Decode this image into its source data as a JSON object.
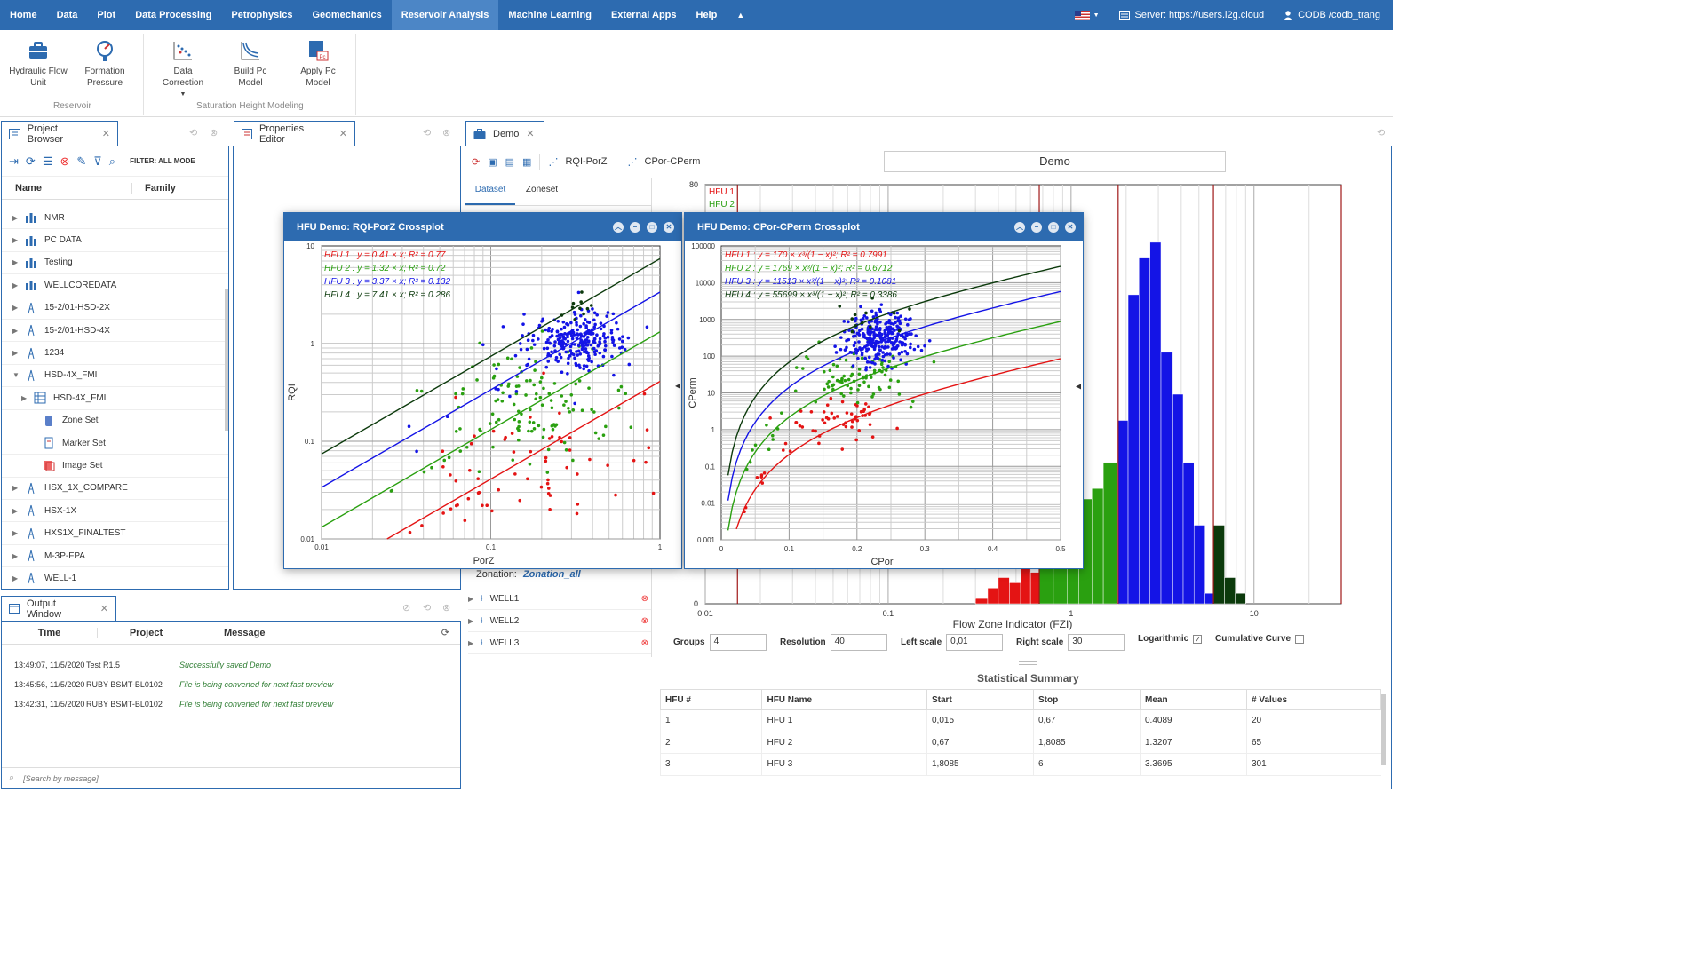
{
  "menu": {
    "items": [
      "Home",
      "Data",
      "Plot",
      "Data Processing",
      "Petrophysics",
      "Geomechanics",
      "Reservoir Analysis",
      "Machine Learning",
      "External Apps",
      "Help"
    ],
    "active": "Reservoir Analysis",
    "server": "Server: https://users.i2g.cloud",
    "user": "CODB /codb_trang"
  },
  "ribbon": {
    "hfu_line1": "Hydraulic Flow",
    "hfu_line2": "Unit",
    "fp_line1": "Formation",
    "fp_line2": "Pressure",
    "dc_line1": "Data",
    "dc_line2": "Correction",
    "bpc_line1": "Build Pc",
    "bpc_line2": "Model",
    "apc_line1": "Apply Pc",
    "apc_line2": "Model",
    "group_reservoir": "Reservoir",
    "group_shm": "Saturation Height Modeling"
  },
  "project": {
    "tab": "Project Browser",
    "filter": "FILTER: ALL MODE",
    "col_name": "Name",
    "col_family": "Family",
    "items": [
      {
        "label": "NMR"
      },
      {
        "label": "PC DATA"
      },
      {
        "label": "Testing"
      },
      {
        "label": "WELLCOREDATA"
      },
      {
        "label": "15-2/01-HSD-2X"
      },
      {
        "label": "15-2/01-HSD-4X"
      },
      {
        "label": "1234"
      },
      {
        "label": "HSD-4X_FMI"
      },
      {
        "label": "HSD-4X_FMI"
      },
      {
        "label": "Zone Set"
      },
      {
        "label": "Marker Set"
      },
      {
        "label": "Image Set"
      },
      {
        "label": "HSX_1X_COMPARE"
      },
      {
        "label": "HSX-1X"
      },
      {
        "label": "HXS1X_FINALTEST"
      },
      {
        "label": "M-3P-FPA"
      },
      {
        "label": "WELL-1"
      }
    ]
  },
  "properties": {
    "tab": "Properties Editor"
  },
  "output": {
    "tab": "Output Window",
    "col_time": "Time",
    "col_project": "Project",
    "col_message": "Message",
    "rows": [
      {
        "time": "13:49:07, 11/5/2020",
        "project": "Test R1.5",
        "message": "Successfully saved Demo"
      },
      {
        "time": "13:45:56, 11/5/2020",
        "project": "RUBY BSMT-BL0102",
        "message": "File is being converted for next fast preview"
      },
      {
        "time": "13:42:31, 11/5/2020",
        "project": "RUBY BSMT-BL0102",
        "message": "File is being converted for next fast preview"
      }
    ],
    "search_placeholder": "[Search by message]"
  },
  "demo": {
    "tab": "Demo",
    "btn_rqi": "RQI-PorZ",
    "btn_cpor": "CPor-CPerm",
    "title": "Demo",
    "subtab_dataset": "Dataset",
    "subtab_zoneset": "Zoneset",
    "zonation_label": "Zonation:",
    "zonation_value": "Zonation_all",
    "wells": [
      "WELL1",
      "WELL2",
      "WELL3"
    ],
    "controls": {
      "groups_label": "Groups",
      "groups": "4",
      "resolution_label": "Resolution",
      "resolution": "40",
      "left_label": "Left scale",
      "left": "0,01",
      "right_label": "Right scale",
      "right": "30",
      "log_label": "Logarithmic",
      "log_checked": true,
      "cum_label": "Cumulative Curve",
      "cum_checked": false
    },
    "summary": {
      "title": "Statistical Summary",
      "headers": [
        "HFU #",
        "HFU Name",
        "Start",
        "Stop",
        "Mean",
        "# Values"
      ],
      "rows": [
        [
          "1",
          "HFU 1",
          "0,015",
          "0,67",
          "0.4089",
          "20"
        ],
        [
          "2",
          "HFU 2",
          "0,67",
          "1,8085",
          "1.3207",
          "65"
        ],
        [
          "3",
          "HFU 3",
          "1,8085",
          "6",
          "3.3695",
          "301"
        ]
      ]
    }
  },
  "windows": {
    "rqi_title": "HFU Demo: RQI-PorZ Crossplot",
    "cpor_title": "HFU Demo: CPor-CPerm Crossplot"
  },
  "colors": {
    "hfu1": "#e41414",
    "hfu2": "#2aa010",
    "hfu3": "#1414e6",
    "hfu4": "#0c3a0c",
    "accent": "#2d6bb0"
  },
  "chart_data": [
    {
      "type": "bar",
      "title": "",
      "xlabel": "Flow Zone Indicator (FZI)",
      "ylabel": "",
      "xscale": "log",
      "xlim": [
        0.01,
        30
      ],
      "ylim": [
        0,
        80
      ],
      "x_ticks": [
        "0.01",
        "0.1",
        "1",
        "10"
      ],
      "y_ticks": [
        "0",
        "80"
      ],
      "legend": [
        "HFU 1",
        "HFU 2"
      ],
      "cutoff_lines": [
        0.015,
        0.67,
        1.8085,
        6,
        30
      ],
      "series": [
        {
          "name": "HFU 1",
          "bins": [
            [
              0.3,
              0.35,
              1
            ],
            [
              0.35,
              0.4,
              3
            ],
            [
              0.4,
              0.46,
              5
            ],
            [
              0.46,
              0.53,
              4
            ],
            [
              0.53,
              0.6,
              7
            ],
            [
              0.6,
              0.67,
              6
            ]
          ]
        },
        {
          "name": "HFU 2",
          "bins": [
            [
              0.67,
              0.8,
              8
            ],
            [
              0.8,
              0.95,
              12
            ],
            [
              0.95,
              1.1,
              16
            ],
            [
              1.1,
              1.3,
              20
            ],
            [
              1.3,
              1.5,
              22
            ],
            [
              1.5,
              1.8,
              27
            ]
          ]
        },
        {
          "name": "HFU 3",
          "bins": [
            [
              1.8,
              2.05,
              35
            ],
            [
              2.05,
              2.35,
              59
            ],
            [
              2.35,
              2.7,
              66
            ],
            [
              2.7,
              3.1,
              69
            ],
            [
              3.1,
              3.6,
              48
            ],
            [
              3.6,
              4.1,
              40
            ],
            [
              4.1,
              4.7,
              27
            ],
            [
              4.7,
              5.4,
              15
            ],
            [
              5.4,
              6,
              2
            ]
          ]
        },
        {
          "name": "HFU 4",
          "bins": [
            [
              6,
              6.9,
              15
            ],
            [
              6.9,
              7.9,
              5
            ],
            [
              7.9,
              9,
              2
            ]
          ]
        }
      ]
    },
    {
      "type": "scatter",
      "title": "HFU Demo: RQI-PorZ Crossplot",
      "xlabel": "PorZ",
      "ylabel": "RQI",
      "xscale": "log",
      "yscale": "log",
      "xlim": [
        0.01,
        1
      ],
      "ylim": [
        0.01,
        10
      ],
      "x_ticks": [
        "0.01",
        "0.1",
        "1"
      ],
      "y_ticks": [
        "0.01",
        "0.1",
        "1",
        "10"
      ],
      "fits": [
        {
          "name": "HFU 1",
          "label": "HFU 1 : y = 0.41 × x; R² = 0.77",
          "slope": 0.41
        },
        {
          "name": "HFU 2",
          "label": "HFU 2 : y = 1.32 × x; R² = 0.72",
          "slope": 1.32
        },
        {
          "name": "HFU 3",
          "label": "HFU 3 : y = 3.37 × x; R² = 0.132",
          "slope": 3.37
        },
        {
          "name": "HFU 4",
          "label": "HFU 4 : y = 7.41 × x; R² = 0.286",
          "slope": 7.41
        }
      ]
    },
    {
      "type": "scatter",
      "title": "HFU Demo: CPor-CPerm Crossplot",
      "xlabel": "CPor",
      "ylabel": "CPerm",
      "yscale": "log",
      "xlim": [
        0,
        0.5
      ],
      "ylim": [
        0.001,
        100000
      ],
      "x_ticks": [
        "0",
        "0.1",
        "0.2",
        "0.3",
        "0.4",
        "0.5"
      ],
      "y_ticks": [
        "0.001",
        "0.01",
        "0.1",
        "1",
        "10",
        "100",
        "1000",
        "10000",
        "100000"
      ],
      "fits": [
        {
          "name": "HFU 1",
          "label": "HFU 1 : y = 170 × x³/(1 − x)²; R² = 0.7991",
          "coef": 170
        },
        {
          "name": "HFU 2",
          "label": "HFU 2 : y = 1769 × x³/(1 − x)²; R² = 0.6712",
          "coef": 1769
        },
        {
          "name": "HFU 3",
          "label": "HFU 3 : y = 11513 × x³/(1 − x)²; R² = 0.1081",
          "coef": 11513
        },
        {
          "name": "HFU 4",
          "label": "HFU 4 : y = 55699 × x³/(1 − x)²; R² = 0.3386",
          "coef": 55699
        }
      ]
    }
  ]
}
